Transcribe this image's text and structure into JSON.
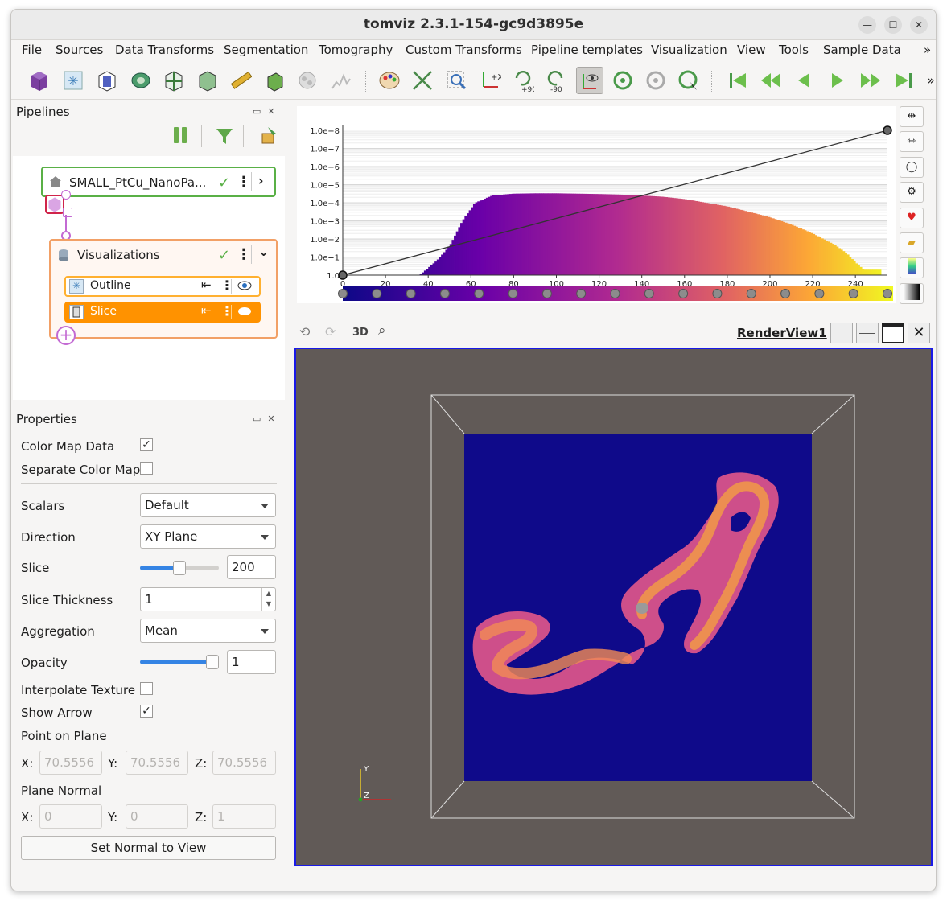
{
  "window": {
    "title": "tomviz 2.3.1-154-gc9d3895e"
  },
  "menu": [
    "File",
    "Sources",
    "Data Transforms",
    "Segmentation",
    "Tomography",
    "Custom Transforms",
    "Pipeline templates",
    "Visualization",
    "View",
    "Tools",
    "Sample Data",
    "»"
  ],
  "toolbar": {
    "rot_plus_label": "+90",
    "rot_minus_label": "-90",
    "more": "»"
  },
  "pipelines": {
    "title": "Pipelines",
    "datasource_label": "SMALL_PtCu_NanoPa...",
    "visualizations_label": "Visualizations",
    "modules": [
      {
        "label": "Outline"
      },
      {
        "label": "Slice"
      }
    ]
  },
  "properties": {
    "title": "Properties",
    "color_map_data_label": "Color Map Data",
    "separate_color_map_label": "Separate Color Map",
    "scalars_label": "Scalars",
    "scalars_value": "Default",
    "direction_label": "Direction",
    "direction_value": "XY Plane",
    "slice_label": "Slice",
    "slice_value": "200",
    "slice_fraction": 0.5,
    "slice_thickness_label": "Slice Thickness",
    "slice_thickness_value": "1",
    "aggregation_label": "Aggregation",
    "aggregation_value": "Mean",
    "opacity_label": "Opacity",
    "opacity_value": "1",
    "interpolate_texture_label": "Interpolate Texture",
    "show_arrow_label": "Show Arrow",
    "point_on_plane_label": "Point on Plane",
    "point": {
      "x_label": "X:",
      "y_label": "Y:",
      "z_label": "Z:",
      "x": "70.5556",
      "y": "70.5556",
      "z": "70.5556"
    },
    "plane_normal_label": "Plane Normal",
    "normal": {
      "x_label": "X:",
      "y_label": "Y:",
      "z_label": "Z:",
      "x": "0",
      "y": "0",
      "z": "1"
    },
    "set_normal_button": "Set Normal to View"
  },
  "histogram": {
    "y_ticks": [
      "1.0e+8",
      "1.0e+7",
      "1.0e+6",
      "1.0e+5",
      "1.0e+4",
      "1.0e+3",
      "1.0e+2",
      "1.0e+1",
      "1.0"
    ],
    "x_ticks": [
      "0",
      "20",
      "40",
      "60",
      "80",
      "100",
      "120",
      "140",
      "160",
      "180",
      "200",
      "220",
      "240"
    ]
  },
  "chart_data": {
    "type": "bar",
    "scale": "log",
    "xlim": [
      0,
      255
    ],
    "ylim_log10": [
      0,
      8
    ],
    "x": [
      36,
      40,
      44,
      50,
      56,
      62,
      70,
      80,
      90,
      100,
      110,
      120,
      130,
      140,
      150,
      160,
      170,
      180,
      190,
      200,
      210,
      220,
      230,
      236,
      240,
      244,
      248,
      252
    ],
    "log10_counts": [
      0,
      0.4,
      0.8,
      1.6,
      3.0,
      4.0,
      4.4,
      4.5,
      4.52,
      4.52,
      4.5,
      4.48,
      4.45,
      4.4,
      4.33,
      4.2,
      4.0,
      3.8,
      3.5,
      3.2,
      2.8,
      2.3,
      1.7,
      1.2,
      0.7,
      0.3,
      0.3,
      0.3
    ],
    "opacity_line": [
      [
        0,
        0
      ],
      [
        255,
        8
      ]
    ]
  },
  "render": {
    "three_d_label": "3D",
    "view_label": "RenderView1",
    "axes": {
      "y": "Y",
      "z": "Z"
    }
  },
  "colors": {
    "purple": "#c36ad3",
    "orange": "#ff9200",
    "green": "#59b046",
    "bg_slice": "#0f0a8a",
    "render_bg": "#615a57"
  }
}
